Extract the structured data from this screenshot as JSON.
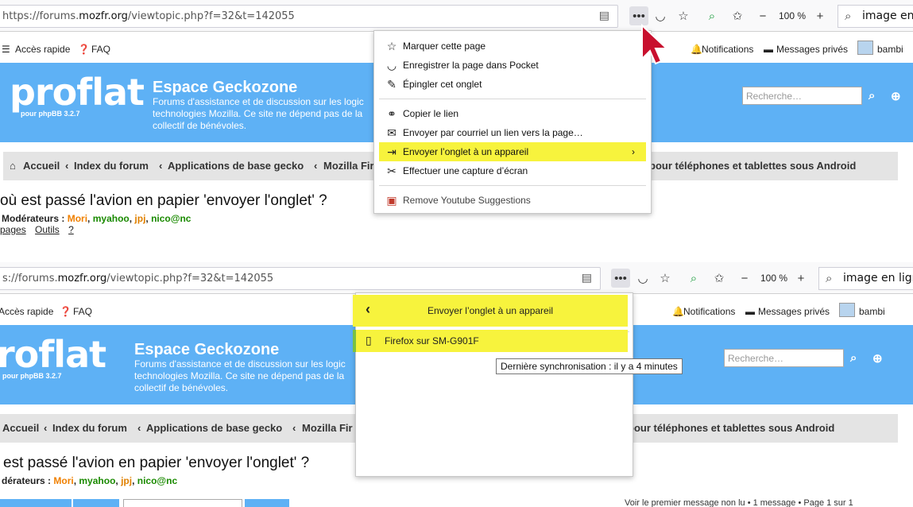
{
  "top": {
    "url_prefix": "https://forums.",
    "url_host": "mozfr.org",
    "url_path": "/viewtopic.php?f=32&t=142055",
    "zoom": "100 %",
    "search_value": "image en lig",
    "nav": {
      "acces_rapide": "Accès rapide",
      "faq": "FAQ",
      "notifications": "Notifications",
      "messages": "Messages privés",
      "user": "bambi"
    },
    "banner": {
      "logo": "proflat",
      "logo_sub": "pour phpBB 3.2.7",
      "title": "Espace Geckozone",
      "description": "Forums d'assistance et de discussion sur les logic\ntechnologies Mozilla. Ce site ne dépend pas de la\ncollectif de bénévoles.",
      "search_placeholder": "Recherche…"
    },
    "crumbs": {
      "home": "Accueil",
      "c1": "Index du forum",
      "c2": "Applications de base gecko",
      "c3": "Mozilla Fir",
      "c4": "pour téléphones et tablettes sous Android"
    },
    "topic_title": "où est passé l'avion en papier 'envoyer l'onglet' ?",
    "moderators_label": "Modérateurs :",
    "moderators": [
      "Mori",
      "myahoo",
      "jpj",
      "nico@nc"
    ],
    "tools": {
      "pages": "pages",
      "outils": "Outils",
      "help": "?"
    },
    "menu": {
      "items": [
        {
          "label": "Marquer cette page",
          "icon": "star-icon"
        },
        {
          "label": "Enregistrer la page dans Pocket",
          "icon": "pocket-icon"
        },
        {
          "label": "Épingler cet onglet",
          "icon": "pin-icon"
        },
        {
          "label": "Copier le lien",
          "icon": "link-icon"
        },
        {
          "label": "Envoyer par courriel un lien vers la page…",
          "icon": "mail-icon"
        },
        {
          "label": "Envoyer l’onglet à un appareil",
          "icon": "send-tab-icon"
        },
        {
          "label": "Effectuer une capture d’écran",
          "icon": "screenshot-icon"
        },
        {
          "label": "Remove Youtube Suggestions",
          "icon": "extension-icon"
        }
      ]
    }
  },
  "bottom": {
    "url_prefix": "s://forums.",
    "url_host": "mozfr.org",
    "url_path": "/viewtopic.php?f=32&t=142055",
    "zoom": "100 %",
    "search_value": "image en ligne",
    "nav": {
      "acces_rapide": "Accès rapide",
      "faq": "FAQ",
      "notifications": "Notifications",
      "messages": "Messages privés",
      "user": "bambi"
    },
    "banner": {
      "logo": "roflat",
      "logo_sub": "pour phpBB 3.2.7",
      "title": "Espace Geckozone",
      "description": "Forums d'assistance et de discussion sur les logic\ntechnologies Mozilla. Ce site ne dépend pas de la\ncollectif de bénévoles.",
      "search_placeholder": "Recherche…"
    },
    "crumbs": {
      "home": "Accueil",
      "c1": "Index du forum",
      "c2": "Applications de base gecko",
      "c3": "Mozilla Fir",
      "c4": "pour téléphones et tablettes sous Android"
    },
    "topic_title": "est passé l'avion en papier 'envoyer l'onglet' ?",
    "moderators_label": "dérateurs :",
    "moderators": [
      "Mori",
      "myahoo",
      "jpj",
      "nico@nc"
    ],
    "footer_right": "Voir le premier message non lu • 1 message • Page 1 sur 1",
    "subpanel": {
      "title": "Envoyer l’onglet à un appareil",
      "device": "Firefox sur SM-G901F"
    },
    "tooltip": "Dernière synchronisation : il y a 4 minutes"
  },
  "colors": {
    "banner": "#5eb1f5",
    "highlight": "#f7f33d",
    "notice": "#f8d48a"
  }
}
